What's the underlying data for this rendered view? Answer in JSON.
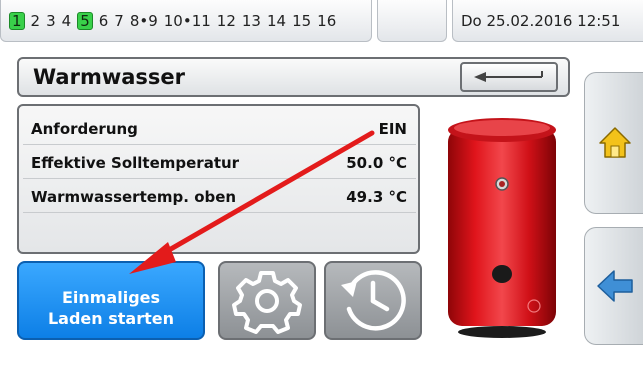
{
  "topbar": {
    "numbers": [
      "1",
      "2",
      "3",
      "4",
      "5",
      "6",
      "7",
      "8•9",
      "10•11",
      "12",
      "13",
      "14",
      "15",
      "16"
    ],
    "active_numbers": [
      "1",
      "5"
    ],
    "datetime": "Do 25.02.2016 12:51"
  },
  "page": {
    "title": "Warmwasser",
    "back_icon": "back-arrow-icon"
  },
  "panel": {
    "rows": [
      {
        "label": "Anforderung",
        "value": "EIN"
      },
      {
        "label": "Effektive Solltemperatur",
        "value": "50.0 °C"
      },
      {
        "label": "Warmwassertemp. oben",
        "value": "49.3 °C"
      }
    ]
  },
  "buttons": {
    "charge_line1": "Einmaliges",
    "charge_line2": "Laden starten",
    "settings_icon": "gear-icon",
    "history_icon": "clock-history-icon"
  },
  "sidebar": {
    "home_icon": "home-icon",
    "back_icon": "left-arrow-icon"
  },
  "colors": {
    "active_green": "#39d04a",
    "button_blue": "#1590f5",
    "tank_red": "#e0141b",
    "annotation_red": "#e31b1b",
    "nav_arrow_blue": "#3f8fd6",
    "home_yellow": "#f3c21a"
  }
}
